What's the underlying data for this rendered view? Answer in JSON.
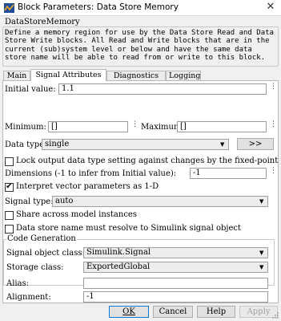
{
  "window": {
    "title": "Block Parameters: Data Store Memory",
    "close_glyph": "✕"
  },
  "block": {
    "name": "DataStoreMemory",
    "description": "Define a memory region for use by the Data Store Read and Data Store Write blocks. All Read and Write blocks that are in the current (sub)system level or below and have the same data store name will be able to read from or write to this block."
  },
  "tabs": [
    {
      "label": "Main",
      "active": false
    },
    {
      "label": "Signal Attributes",
      "active": true
    },
    {
      "label": "Diagnostics",
      "active": false
    },
    {
      "label": "Logging",
      "active": false
    }
  ],
  "signal_attributes": {
    "initial_value_label": "Initial value:",
    "initial_value": "1.1",
    "minimum_label": "Minimum:",
    "minimum_value": "[]",
    "maximum_label": "Maximum:",
    "maximum_value": "[]",
    "data_type_label": "Data type:",
    "data_type_value": "single",
    "data_type_assistant_label": ">>",
    "lock_scaling_label": "Lock output data type setting against changes by the fixed-point t…",
    "lock_scaling_checked": false,
    "dimensions_label": "Dimensions (-1 to infer from Initial value):",
    "dimensions_value": "-1",
    "interpret_vector_label": "Interpret vector parameters as 1-D",
    "interpret_vector_checked": true,
    "signal_type_label": "Signal type:",
    "signal_type_value": "auto",
    "share_across_label": "Share across model instances",
    "share_across_checked": false,
    "resolve_label": "Data store name must resolve to Simulink signal object",
    "resolve_checked": false
  },
  "code_generation": {
    "group_title": "Code Generation",
    "signal_object_class_label": "Signal object class:",
    "signal_object_class_value": "Simulink.Signal",
    "storage_class_label": "Storage class:",
    "storage_class_value": "ExportedGlobal",
    "alias_label": "Alias:",
    "alias_value": "",
    "alignment_label": "Alignment:",
    "alignment_value": "-1"
  },
  "footer": {
    "ok_label": "OK",
    "cancel_label": "Cancel",
    "help_label": "Help",
    "apply_label": "Apply"
  },
  "icons": {
    "dots": "⋮",
    "caret": "▼",
    "check": "✔"
  },
  "colors": {
    "accent": "#0078d7",
    "window_bg": "#f0f0f0",
    "panel_bg": "#ffffff"
  }
}
